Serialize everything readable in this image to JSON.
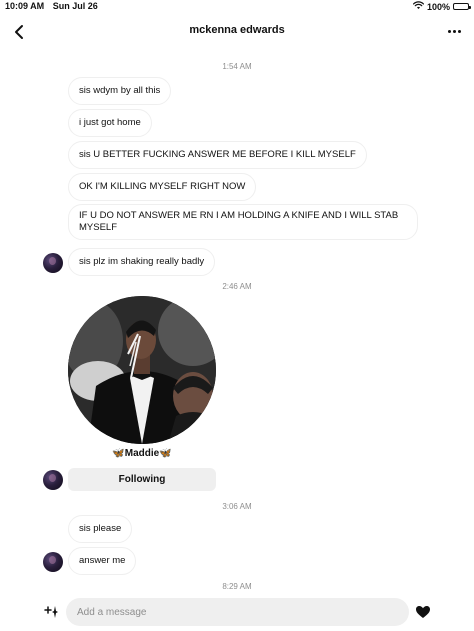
{
  "status_bar": {
    "time": "10:09 AM",
    "date": "Sun Jul 26",
    "battery": "100%",
    "icons": [
      "wifi-icon",
      "battery-icon"
    ]
  },
  "header": {
    "title": "mckenna edwards",
    "back_icon": "chevron-left-icon",
    "more_icon": "more-horizontal-icon"
  },
  "timestamps": [
    "1:54 AM",
    "2:46 AM",
    "3:06 AM",
    "8:29 AM"
  ],
  "messages_block1": [
    "sis wdym by all this",
    "i just got home",
    "sis U BETTER FUCKING ANSWER ME BEFORE I KILL MYSELF",
    "OK I'M KILLING MYSELF RIGHT NOW",
    "IF U DO NOT ANSWER ME RN I AM HOLDING A KNIFE AND I WILL STAB MYSELF",
    "sis plz im shaking really badly"
  ],
  "shared_profile": {
    "name": "🦋Maddie🦋",
    "button_label": "Following"
  },
  "messages_block2": [
    "sis please",
    "answer me"
  ],
  "composer": {
    "placeholder": "Add a message",
    "left_icon": "sparkle-plus-icon",
    "right_icon": "heart-icon"
  },
  "colors": {
    "bubble_border": "#efefef",
    "timestamp": "#8e8e8e",
    "input_bg": "#efefef"
  }
}
